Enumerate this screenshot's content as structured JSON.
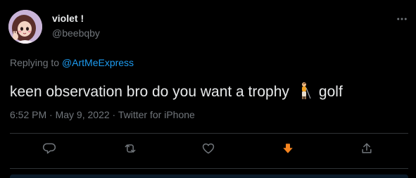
{
  "tweet": {
    "display_name": "violet !",
    "handle": "@beebqby",
    "replying_prefix": "Replying to ",
    "replying_to": "@ArtMeExpress",
    "text_before_emoji": "keen observation bro do you want a trophy",
    "emoji": "golf-person-emoji",
    "text_after_emoji": "golf",
    "time": "6:52 PM",
    "separator": " · ",
    "date": "May 9, 2022",
    "source": "Twitter for iPhone"
  },
  "actions": [
    {
      "name": "reply",
      "icon": "reply-icon"
    },
    {
      "name": "retweet",
      "icon": "retweet-icon"
    },
    {
      "name": "like",
      "icon": "heart-icon"
    },
    {
      "name": "down-arrow",
      "icon": "arrow-down-icon"
    },
    {
      "name": "share",
      "icon": "share-icon"
    }
  ],
  "colors": {
    "background": "#000000",
    "text_primary": "#e7e9ea",
    "text_secondary": "#71767b",
    "link": "#1d9bf0",
    "divider": "#2f3336",
    "accent_orange": "#f5841f"
  }
}
